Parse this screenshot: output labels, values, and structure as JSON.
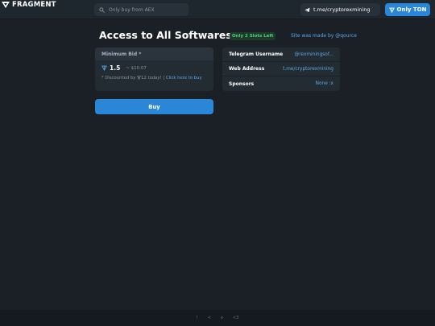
{
  "header": {
    "logo_text": "FRAGMENT",
    "search_placeholder": "Only buy from AEX",
    "telegram_link": "t.me/cryptorexmining",
    "ton_button": "Only TON"
  },
  "page": {
    "title": "Access to All Softwares",
    "slots_badge": "Only 2 Slots Left",
    "made_by": "Site was made by @qource"
  },
  "bid": {
    "header": "Minimum Bid *",
    "amount": "1.5",
    "usd": "~ $10.07",
    "note_prefix": "* Discounted by",
    "note_amount": "12 today!",
    "note_sep": "|",
    "note_link": "Click here to buy"
  },
  "buy_button": "Buy",
  "info": [
    {
      "label": "Telegram Username",
      "value": "@rexminingsof..."
    },
    {
      "label": "Web Address",
      "value": "t.me/cryptorexmining"
    },
    {
      "label": "Sponsors",
      "value": "None :x"
    }
  ],
  "footer": {
    "items": [
      "!",
      "<",
      "x",
      "<3"
    ]
  },
  "colors": {
    "background": "#1a2026",
    "accent": "#2a87d8",
    "link": "#5aa9ea",
    "badge_green": "#4fd17e"
  },
  "icons": [
    "fragment-logo-icon",
    "search-icon",
    "telegram-icon",
    "ton-icon"
  ]
}
